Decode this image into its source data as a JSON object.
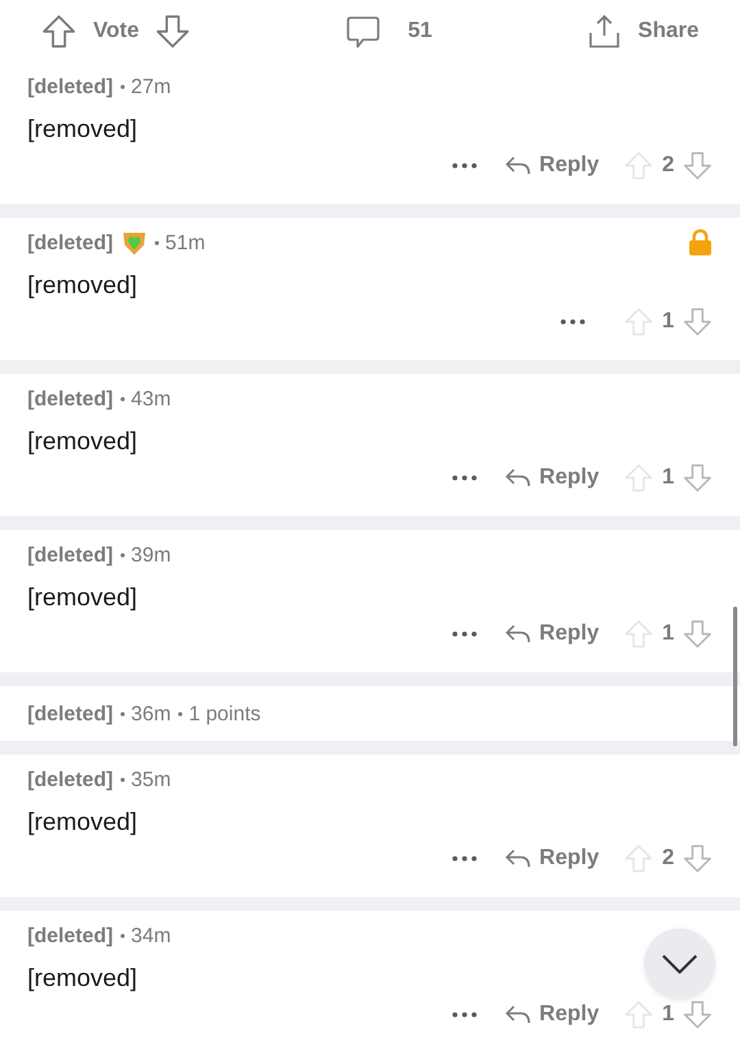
{
  "post_bar": {
    "vote_label": "Vote",
    "comment_count": "51",
    "share_label": "Share"
  },
  "comments": [
    {
      "author": "[deleted]",
      "time": "27m",
      "award": false,
      "locked": false,
      "collapsed": false,
      "body": "[removed]",
      "reply_label": "Reply",
      "score": "2"
    },
    {
      "author": "[deleted]",
      "time": "51m",
      "award": true,
      "locked": true,
      "collapsed": false,
      "body": "[removed]",
      "score": "1"
    },
    {
      "author": "[deleted]",
      "time": "43m",
      "award": false,
      "locked": false,
      "collapsed": false,
      "body": "[removed]",
      "reply_label": "Reply",
      "score": "1"
    },
    {
      "author": "[deleted]",
      "time": "39m",
      "award": false,
      "locked": false,
      "collapsed": false,
      "body": "[removed]",
      "reply_label": "Reply",
      "score": "1"
    },
    {
      "author": "[deleted]",
      "time": "36m",
      "points": "1 points",
      "award": false,
      "locked": false,
      "collapsed": true
    },
    {
      "author": "[deleted]",
      "time": "35m",
      "award": false,
      "locked": false,
      "collapsed": false,
      "body": "[removed]",
      "reply_label": "Reply",
      "score": "2"
    },
    {
      "author": "[deleted]",
      "time": "34m",
      "award": false,
      "locked": false,
      "collapsed": false,
      "body": "[removed]",
      "reply_label": "Reply",
      "score": "1"
    }
  ]
}
